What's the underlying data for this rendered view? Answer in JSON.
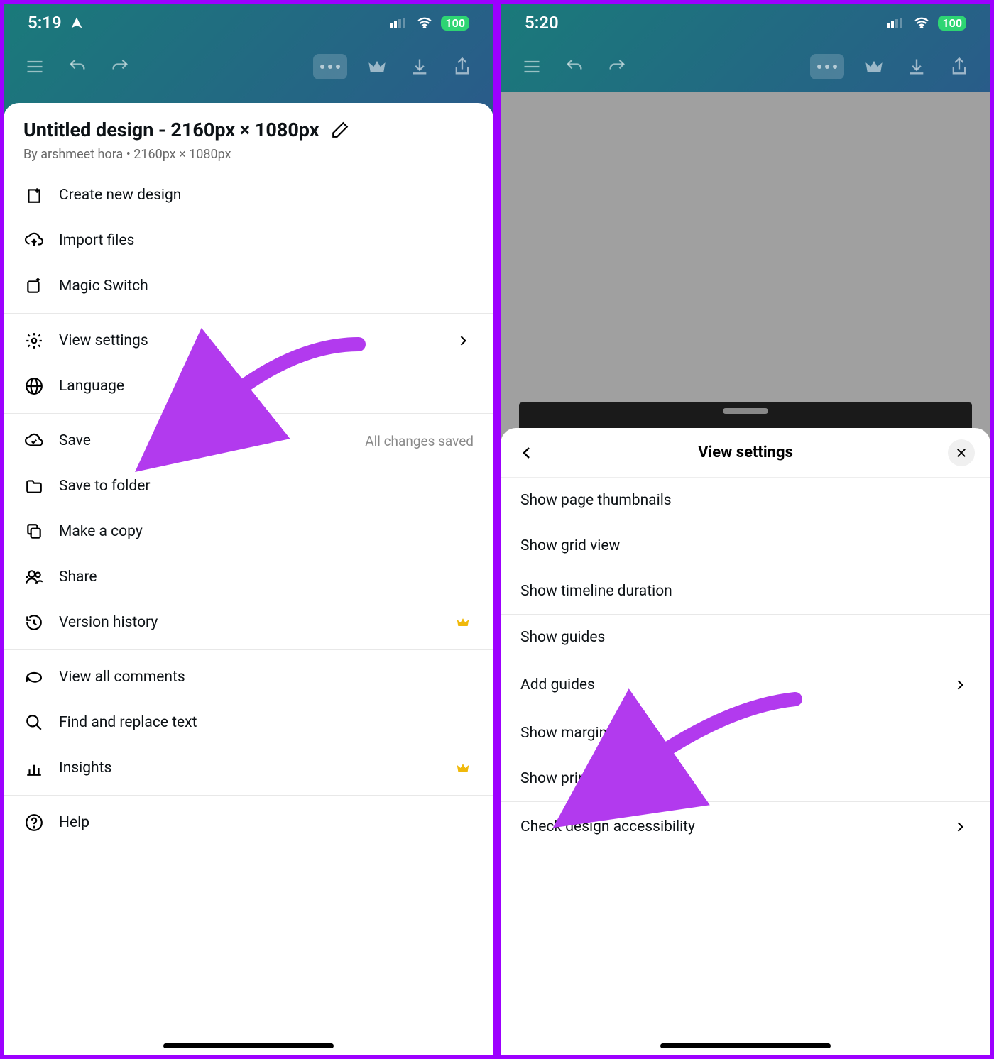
{
  "left": {
    "status": {
      "time": "5:19",
      "battery": "100"
    },
    "sheet": {
      "title": "Untitled design - 2160px × 1080px",
      "subtitle": "By arshmeet hora • 2160px × 1080px",
      "items": {
        "create": "Create new design",
        "import": "Import files",
        "magic": "Magic Switch",
        "view_settings": "View settings",
        "language": "Language",
        "save": "Save",
        "save_status": "All changes saved",
        "save_folder": "Save to folder",
        "copy": "Make a copy",
        "share": "Share",
        "version": "Version history",
        "comments": "View all comments",
        "find": "Find and replace text",
        "insights": "Insights",
        "help": "Help"
      }
    }
  },
  "right": {
    "status": {
      "time": "5:20",
      "battery": "100"
    },
    "sheet": {
      "title": "View settings",
      "items": {
        "thumbs": "Show page thumbnails",
        "grid": "Show grid view",
        "timeline": "Show timeline duration",
        "guides": "Show guides",
        "add_guides": "Add guides",
        "margins": "Show margins",
        "bleed": "Show print bleed",
        "a11y": "Check design accessibility"
      }
    }
  }
}
